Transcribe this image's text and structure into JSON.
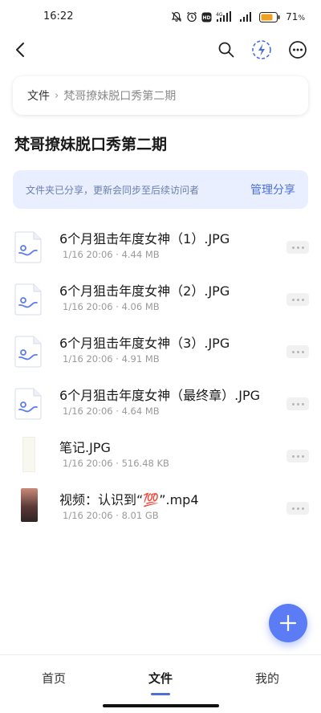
{
  "status_bar": {
    "time": "16:22",
    "network_label": "4G",
    "hd_label": "HD",
    "battery_percent": "71",
    "battery_unit": "%",
    "battery_color": "#f0a020"
  },
  "top_bar": {
    "back_icon": "chevron-left-icon",
    "search_icon": "search-icon",
    "flash_icon": "lightning-icon",
    "more_icon": "more-circle-icon"
  },
  "breadcrumb": {
    "root": "文件",
    "separator": "›",
    "current": "梵哥撩妹脱口秀第二期"
  },
  "folder_title": "梵哥撩妹脱口秀第二期",
  "share_banner": {
    "text": "文件夹已分享，更新会同步至后续访问者",
    "action": "管理分享"
  },
  "files": [
    {
      "name": "6个月狙击年度女神（1）.JPG",
      "meta": "1/16 20:06 · 4.44 MB",
      "thumb": "doc"
    },
    {
      "name": "6个月狙击年度女神（2）.JPG",
      "meta": "1/16 20:06 · 4.06 MB",
      "thumb": "doc"
    },
    {
      "name": "6个月狙击年度女神（3）.JPG",
      "meta": "1/16 20:06 · 4.91 MB",
      "thumb": "doc"
    },
    {
      "name": "6个月狙击年度女神（最终章）.JPG",
      "meta": "1/16 20:06 · 4.64 MB",
      "thumb": "doc"
    },
    {
      "name": "笔记.JPG",
      "meta": "1/16 20:06 · 516.48 KB",
      "thumb": "notes"
    },
    {
      "name": "视频：认识到“💯”.mp4",
      "meta": "1/16 20:06 · 8.01 GB",
      "thumb": "video"
    }
  ],
  "tabs": [
    {
      "label": "首页",
      "active": false
    },
    {
      "label": "文件",
      "active": true
    },
    {
      "label": "我的",
      "active": false
    }
  ],
  "colors": {
    "accent": "#4d6fd8",
    "fab": "#5b7cf5",
    "banner_bg": "#e9efff"
  }
}
